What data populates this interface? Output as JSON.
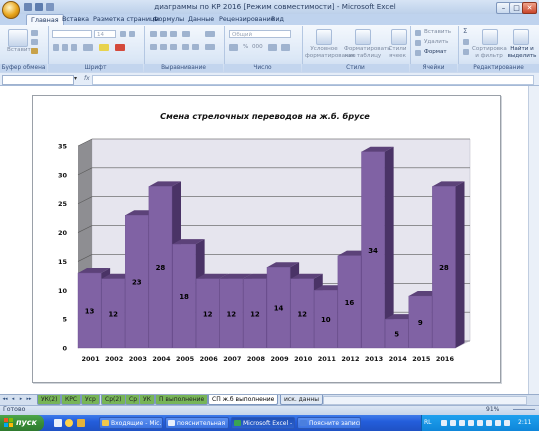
{
  "window": {
    "title": "диаграммы по КР 2016  [Режим совместимости] - Microsoft Excel",
    "buttons": {
      "minimize": "–",
      "maximize": "□",
      "close": "✕"
    }
  },
  "ribbon": {
    "tabs": [
      "Главная",
      "Вставка",
      "Разметка страницы",
      "Формулы",
      "Данные",
      "Рецензирование",
      "Вид"
    ],
    "active_tab": "Главная",
    "groups": [
      "Буфер обмена",
      "Шрифт",
      "Выравнивание",
      "Число",
      "Стили",
      "Ячейки",
      "Редактирование"
    ],
    "paste_label": "Вставить",
    "font_size": "14",
    "number_format": "Общий",
    "percent": "%",
    "thousands": "000",
    "styles": [
      "Условное форматирование",
      "Форматировать как таблицу",
      "Стили ячеек"
    ],
    "cells": [
      "Вставить",
      "Удалить",
      "Формат"
    ],
    "editing": [
      "Сортировка и фильтр",
      "Найти и выделить"
    ],
    "sum_symbol": "Σ"
  },
  "formula_bar": {
    "fx": "fx",
    "dropdown": "▾",
    "name_box": "",
    "value": ""
  },
  "sheet_tabs": {
    "nav": [
      "◂◂",
      "◂",
      "▸",
      "▸▸"
    ],
    "tabs": [
      "УК(2)",
      "КРС",
      "Уср",
      "Ср(2)",
      "Ср",
      "УК",
      "П выполнение",
      "СП ж.б выполнение",
      "иск. данны"
    ],
    "active": "СП ж.б выполнение"
  },
  "status_bar": {
    "status": "Готово",
    "zoom": "91%"
  },
  "taskbar": {
    "start": "пуск",
    "items": [
      "Входящие - Mic...",
      "пояснительная",
      "Microsoft Excel - ...",
      "Поясните записк..."
    ],
    "active_index": 2,
    "language": "RL",
    "clock": "2:11"
  },
  "chart_data": {
    "type": "bar",
    "title": "Смена стрелочных переводов на ж.б. брусе",
    "categories": [
      "2001",
      "2002",
      "2003",
      "2004",
      "2005",
      "2006",
      "2007",
      "2008",
      "2009",
      "2010",
      "2011",
      "2012",
      "2013",
      "2014",
      "2015",
      "2016"
    ],
    "values": [
      13,
      12,
      23,
      28,
      18,
      12,
      12,
      12,
      14,
      12,
      10,
      16,
      34,
      5,
      9,
      28
    ],
    "xlabel": "",
    "ylabel": "",
    "ylim": [
      0,
      35
    ],
    "yticks": [
      0,
      5,
      10,
      15,
      20,
      25,
      30,
      35
    ],
    "grid": true,
    "legend": "none",
    "bar_color": "#8062a4",
    "bar_top_color": "#5c4279",
    "bar_side_color": "#4a3366",
    "wall_color": "#e6e5ee",
    "side_wall_color": "#8e8e92"
  }
}
